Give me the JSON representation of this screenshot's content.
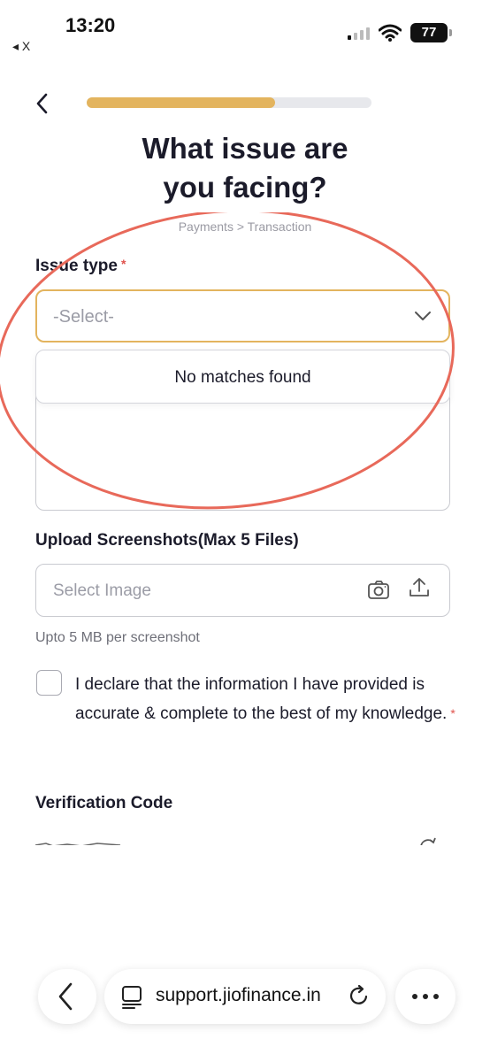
{
  "status_bar": {
    "time": "13:20",
    "back_label": "◂ X",
    "battery": "77"
  },
  "header": {
    "progress_fraction": 0.66,
    "title_line1": "What issue are",
    "title_line2": "you facing?",
    "breadcrumb": "Payments > Transaction"
  },
  "form": {
    "issue_type_label": "Issue type",
    "required_mark": "*",
    "issue_type_placeholder": "-Select-",
    "dropdown_empty_text": "No matches found",
    "upload_label": "Upload Screenshots(Max 5 Files)",
    "upload_placeholder": "Select Image",
    "upload_hint": "Upto 5 MB per screenshot",
    "declaration_text": "I declare that the information I have provided is accurate & complete to the best of my knowledge.",
    "verification_label": "Verification Code"
  },
  "browser": {
    "url": "support.jiofinance.in"
  },
  "colors": {
    "accent": "#e3b45e",
    "annotation": "#e8695a",
    "required": "#e0524c"
  },
  "icons": [
    "chevron-left-icon",
    "chevron-down-icon",
    "camera-icon",
    "upload-icon",
    "page-icon",
    "reload-icon",
    "more-icon"
  ]
}
